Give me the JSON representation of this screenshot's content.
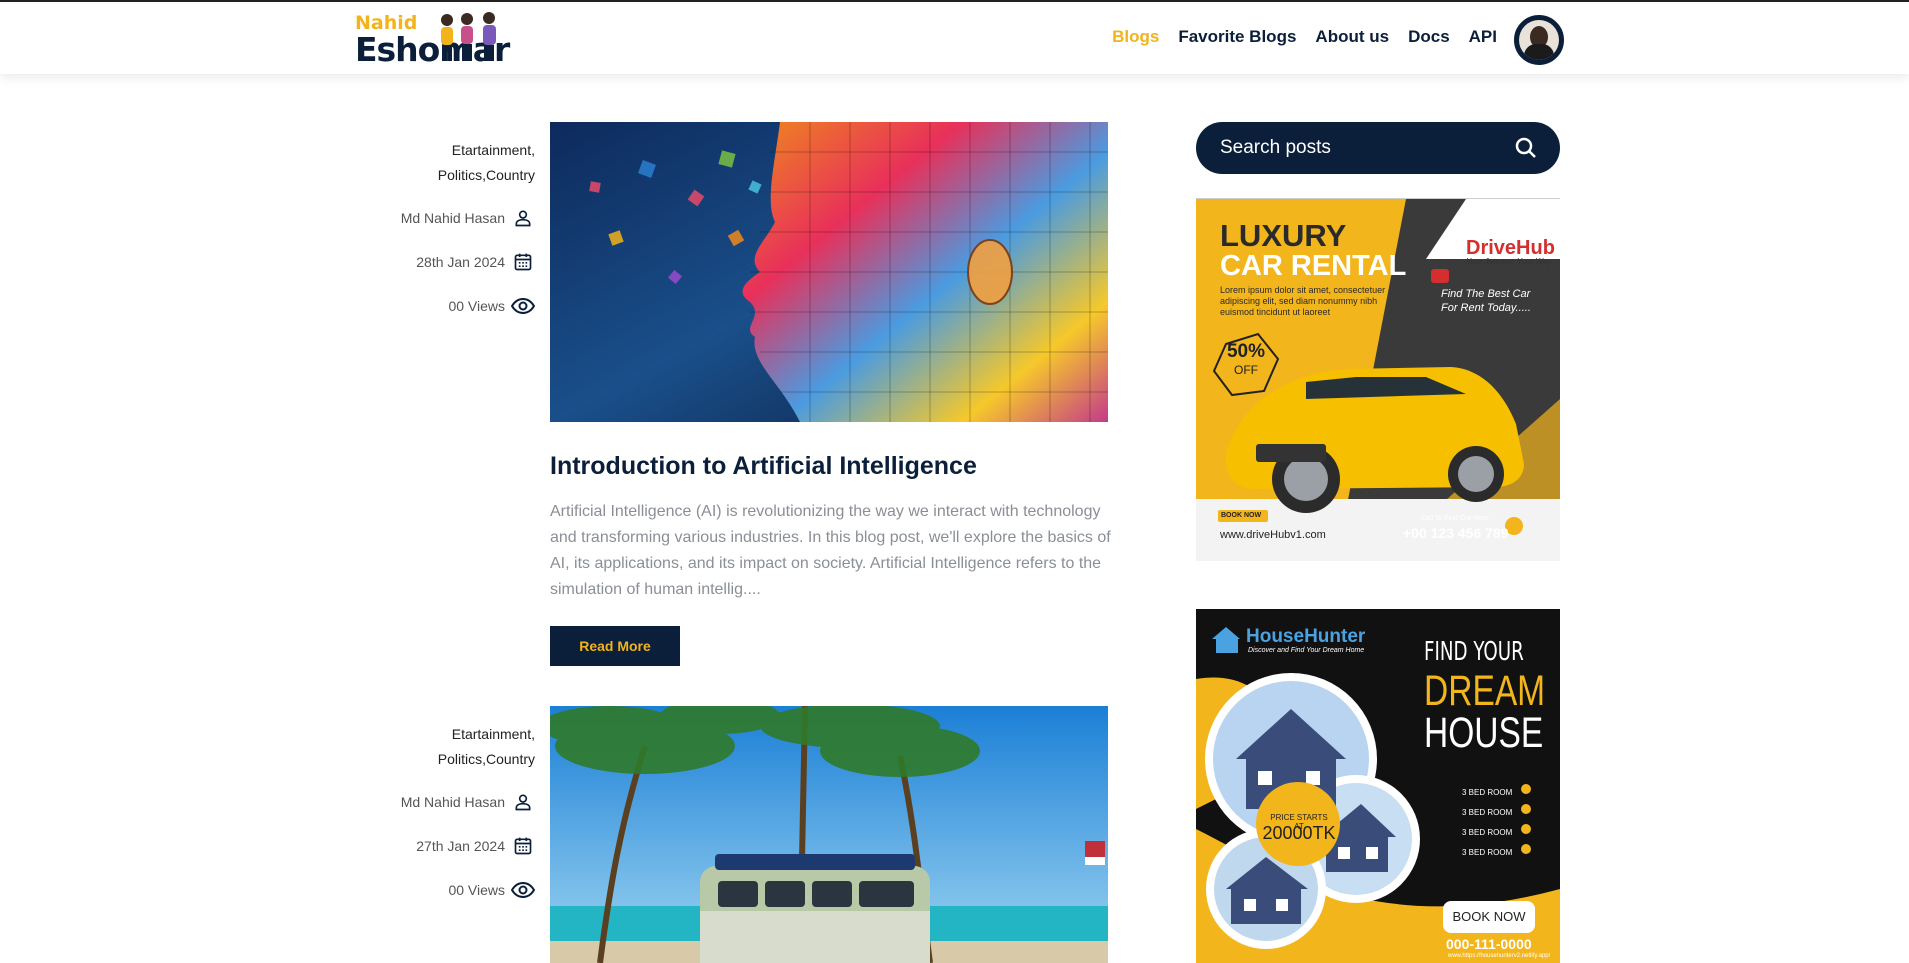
{
  "brand": {
    "top": "Nahid",
    "bottom": "Eshomar"
  },
  "nav": [
    {
      "label": "Blogs",
      "active": true
    },
    {
      "label": "Favorite Blogs",
      "active": false
    },
    {
      "label": "About us",
      "active": false
    },
    {
      "label": "Docs",
      "active": false
    },
    {
      "label": "API",
      "active": false
    }
  ],
  "search": {
    "placeholder": "Search posts"
  },
  "posts": [
    {
      "categories_line1": "Etartainment,",
      "categories_line2": "Politics,Country",
      "author": "Md Nahid Hasan",
      "date": "28th Jan 2024",
      "views": "00 Views",
      "title": "Introduction to Artificial Intelligence",
      "excerpt": "Artificial Intelligence (AI) is revolutionizing the way we interact with technology and transforming various industries. In this blog post, we'll explore the basics of AI, its applications, and its impact on society. Artificial Intelligence refers to the simulation of human intellig....",
      "read_more": "Read More"
    },
    {
      "categories_line1": "Etartainment,",
      "categories_line2": "Politics,Country",
      "author": "Md Nahid Hasan",
      "date": "27th Jan 2024",
      "views": "00 Views"
    }
  ],
  "ads": {
    "car": {
      "headline1": "LUXURY",
      "headline2": "CAR RENTAL",
      "brand": "DriveHub",
      "tagline": "Your Journey, Your Way",
      "body": "Lorem ipsum dolor sit amet, consectetuer adipiscing elit, sed diam nonummy nibh euismod tincidunt ut laoreet",
      "side_text1": "Find The Best Car",
      "side_text2": "For Rent Today.....",
      "discount": "50%",
      "off": "OFF",
      "book": "BOOK NOW",
      "url": "www.driveHubv1.com",
      "call_label": "Call To Find Out More",
      "phone": "+00 123 456 789"
    },
    "house": {
      "brand": "HouseHunter",
      "tagline": "Discover and Find Your Dream Home",
      "line1": "FIND YOUR",
      "line2": "DREAM",
      "line3": "HOUSE",
      "price_label": "PRICE STARTS AT",
      "price": "20000TK",
      "rooms": [
        "3 BED ROOM",
        "3 BED ROOM",
        "3 BED ROOM",
        "3 BED ROOM"
      ],
      "book": "BOOK NOW",
      "phone": "000-111-0000",
      "url": "www.https://househunterv2.netlify.app/"
    }
  }
}
